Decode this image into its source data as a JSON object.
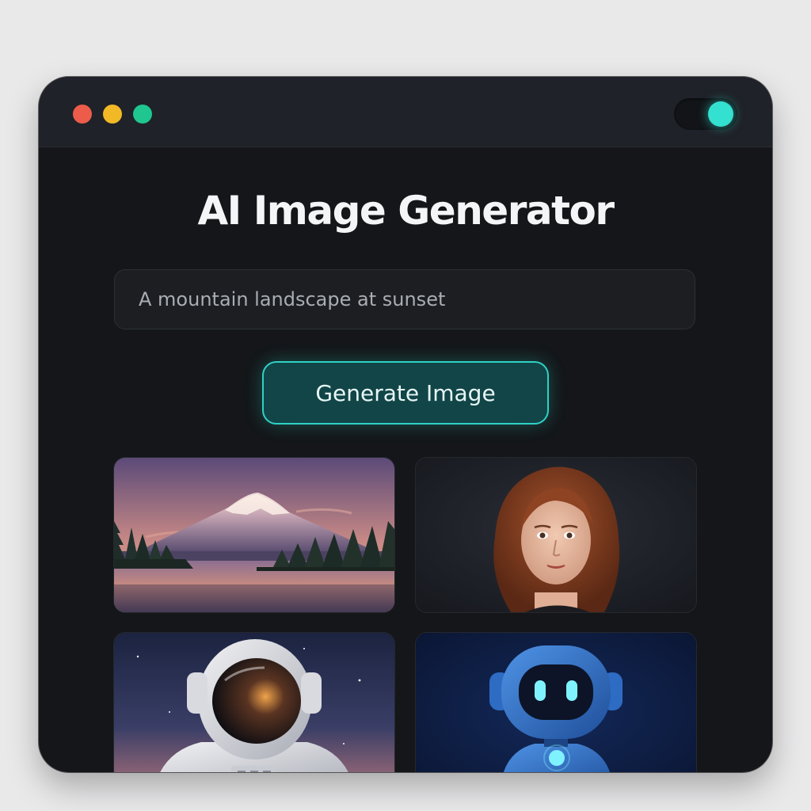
{
  "window": {
    "traffic_lights": [
      "close",
      "minimize",
      "maximize"
    ],
    "theme_toggle": {
      "state": "on",
      "accent": "#34e0cf"
    }
  },
  "header": {
    "title": "AI Image Generator"
  },
  "prompt": {
    "value": "A mountain landscape at sunset"
  },
  "actions": {
    "generate_label": "Generate Image"
  },
  "gallery": {
    "items": [
      {
        "subject": "mountain-landscape-at-sunset"
      },
      {
        "subject": "portrait-of-woman-with-red-hair"
      },
      {
        "subject": "astronaut-in-space"
      },
      {
        "subject": "blue-robot"
      }
    ]
  },
  "colors": {
    "accent": "#2fd1c4",
    "background": "#141619",
    "titlebar": "#1f2228"
  }
}
